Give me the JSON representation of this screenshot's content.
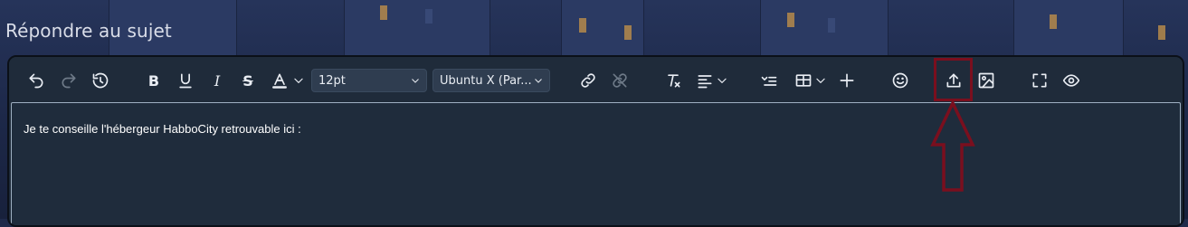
{
  "page": {
    "title": "Répondre au sujet"
  },
  "toolbar": {
    "font_size_value": "12pt",
    "font_family_value": "Ubuntu X (Par..."
  },
  "editor": {
    "content_text": "Je te conseille l'hébergeur HabboCity retrouvable ici :"
  },
  "colors": {
    "highlight": "#7a0f1e",
    "editor_bg": "#1f2b3a"
  },
  "icons": [
    "undo-icon",
    "redo-icon",
    "history-icon",
    "bold-icon",
    "underline-icon",
    "italic-icon",
    "strikethrough-icon",
    "text-color-icon",
    "link-icon",
    "unlink-icon",
    "clear-format-icon",
    "align-icon",
    "list-icon",
    "table-icon",
    "plus-icon",
    "emoji-icon",
    "upload-icon",
    "image-icon",
    "fullscreen-icon",
    "preview-icon"
  ]
}
